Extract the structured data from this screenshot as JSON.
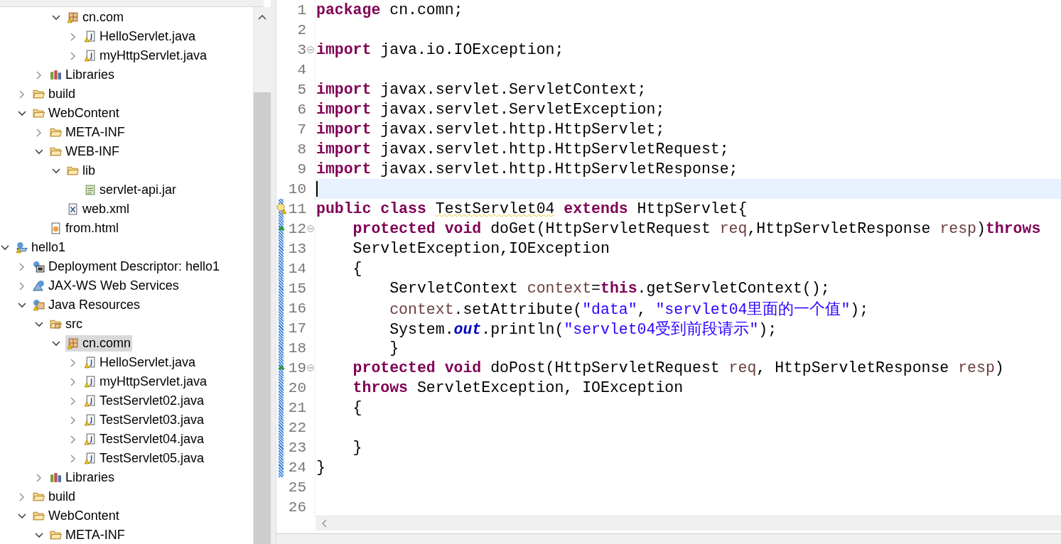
{
  "tree": [
    {
      "children": [
        {
          "children": [
            {
              "children": [
                {
                  "label": "cn.com",
                  "kind": "package",
                  "expanded": true,
                  "selected": false,
                  "children": [
                    {
                      "label": "HelloServlet.java",
                      "kind": "java-file",
                      "expanded": false,
                      "selected": false
                    },
                    {
                      "label": "myHttpServlet.java",
                      "kind": "java-file",
                      "expanded": false,
                      "selected": false
                    }
                  ]
                }
              ]
            },
            {
              "label": "Libraries",
              "kind": "library",
              "expanded": false,
              "selected": false
            }
          ]
        },
        {
          "label": "build",
          "kind": "folder",
          "expanded": false,
          "selected": false
        },
        {
          "label": "WebContent",
          "kind": "folder",
          "expanded": true,
          "selected": false,
          "children": [
            {
              "label": "META-INF",
              "kind": "folder",
              "expanded": false,
              "selected": false
            },
            {
              "label": "WEB-INF",
              "kind": "folder",
              "expanded": true,
              "selected": false,
              "children": [
                {
                  "label": "lib",
                  "kind": "folder",
                  "expanded": true,
                  "selected": false,
                  "children": [
                    {
                      "label": "servlet-api.jar",
                      "kind": "jar",
                      "selected": false
                    }
                  ]
                },
                {
                  "label": "web.xml",
                  "kind": "xml",
                  "selected": false
                }
              ]
            },
            {
              "label": "from.html",
              "kind": "html",
              "selected": false
            }
          ]
        }
      ]
    },
    {
      "label": "hello1",
      "kind": "project",
      "expanded": true,
      "selected": false,
      "children": [
        {
          "label": "Deployment Descriptor: hello1",
          "kind": "descriptor",
          "expanded": false,
          "selected": false
        },
        {
          "label": "JAX-WS Web Services",
          "kind": "web-services",
          "expanded": false,
          "selected": false
        },
        {
          "label": "Java Resources",
          "kind": "java-resources",
          "expanded": true,
          "selected": false,
          "children": [
            {
              "label": "src",
              "kind": "src-folder",
              "expanded": true,
              "selected": false,
              "children": [
                {
                  "label": "cn.comn",
                  "kind": "package",
                  "expanded": true,
                  "selected": true,
                  "children": [
                    {
                      "label": "HelloServlet.java",
                      "kind": "java-file",
                      "expanded": false,
                      "selected": false
                    },
                    {
                      "label": "myHttpServlet.java",
                      "kind": "java-file",
                      "expanded": false,
                      "selected": false
                    },
                    {
                      "label": "TestServlet02.java",
                      "kind": "java-file",
                      "expanded": false,
                      "selected": false
                    },
                    {
                      "label": "TestServlet03.java",
                      "kind": "java-file",
                      "expanded": false,
                      "selected": false
                    },
                    {
                      "label": "TestServlet04.java",
                      "kind": "java-file",
                      "expanded": false,
                      "selected": false
                    },
                    {
                      "label": "TestServlet05.java",
                      "kind": "java-file",
                      "expanded": false,
                      "selected": false
                    }
                  ]
                }
              ]
            },
            {
              "label": "Libraries",
              "kind": "library",
              "expanded": false,
              "selected": false
            }
          ]
        },
        {
          "label": "build",
          "kind": "folder",
          "expanded": false,
          "selected": false
        },
        {
          "label": "WebContent",
          "kind": "folder",
          "expanded": true,
          "selected": false,
          "children": [
            {
              "label": "META-INF",
              "kind": "folder",
              "expanded": true,
              "selected": false
            }
          ]
        }
      ]
    }
  ],
  "editor": {
    "lines": [
      {
        "number": "1",
        "current": false,
        "changed": false,
        "fold": false,
        "warning": false,
        "override": false,
        "segments": [
          {
            "kind": "keyword",
            "text": "package"
          },
          {
            "kind": "plain",
            "text": " cn.comn;"
          }
        ]
      },
      {
        "number": "2",
        "current": false,
        "changed": false,
        "fold": false,
        "warning": false,
        "override": false
      },
      {
        "number": "3",
        "current": false,
        "changed": false,
        "fold": true,
        "warning": false,
        "override": false,
        "segments": [
          {
            "kind": "keyword",
            "text": "import"
          },
          {
            "kind": "plain",
            "text": " java.io.IOException;"
          }
        ]
      },
      {
        "number": "4",
        "current": false,
        "changed": false,
        "fold": false,
        "warning": false,
        "override": false
      },
      {
        "number": "5",
        "current": false,
        "changed": false,
        "fold": false,
        "warning": false,
        "override": false,
        "segments": [
          {
            "kind": "keyword",
            "text": "import"
          },
          {
            "kind": "plain",
            "text": " javax.servlet.ServletContext;"
          }
        ]
      },
      {
        "number": "6",
        "current": false,
        "changed": false,
        "fold": false,
        "warning": false,
        "override": false,
        "segments": [
          {
            "kind": "keyword",
            "text": "import"
          },
          {
            "kind": "plain",
            "text": " javax.servlet.ServletException;"
          }
        ]
      },
      {
        "number": "7",
        "current": false,
        "changed": false,
        "fold": false,
        "warning": false,
        "override": false,
        "segments": [
          {
            "kind": "keyword",
            "text": "import"
          },
          {
            "kind": "plain",
            "text": " javax.servlet.http.HttpServlet;"
          }
        ]
      },
      {
        "number": "8",
        "current": false,
        "changed": false,
        "fold": false,
        "warning": false,
        "override": false,
        "segments": [
          {
            "kind": "keyword",
            "text": "import"
          },
          {
            "kind": "plain",
            "text": " javax.servlet.http.HttpServletRequest;"
          }
        ]
      },
      {
        "number": "9",
        "current": false,
        "changed": false,
        "fold": false,
        "warning": false,
        "override": false,
        "segments": [
          {
            "kind": "keyword",
            "text": "import"
          },
          {
            "kind": "plain",
            "text": " javax.servlet.http.HttpServletResponse;"
          }
        ]
      },
      {
        "number": "10",
        "current": true,
        "changed": false,
        "fold": false,
        "warning": false,
        "override": false
      },
      {
        "number": "11",
        "current": false,
        "changed": true,
        "fold": false,
        "warning": true,
        "override": false,
        "segments": [
          {
            "kind": "keyword",
            "text": "public class "
          },
          {
            "kind": "warning",
            "text": "TestServlet04"
          },
          {
            "kind": "keyword",
            "text": " extends"
          },
          {
            "kind": "plain",
            "text": " HttpServlet{"
          }
        ]
      },
      {
        "number": "12",
        "current": false,
        "changed": true,
        "fold": true,
        "warning": false,
        "override": true,
        "segments": [
          {
            "kind": "keyword",
            "text": "    protected void"
          },
          {
            "kind": "plain",
            "text": " doGet(HttpServletRequest "
          },
          {
            "kind": "variable",
            "text": "req"
          },
          {
            "kind": "plain",
            "text": ",HttpServletResponse "
          },
          {
            "kind": "variable",
            "text": "resp"
          },
          {
            "kind": "plain",
            "text": ")"
          },
          {
            "kind": "keyword",
            "text": "throws"
          }
        ]
      },
      {
        "number": "13",
        "current": false,
        "changed": true,
        "fold": false,
        "warning": false,
        "override": false,
        "segments": [
          {
            "kind": "plain",
            "text": "    ServletException,IOException"
          }
        ]
      },
      {
        "number": "14",
        "current": false,
        "changed": true,
        "fold": false,
        "warning": false,
        "override": false,
        "segments": [
          {
            "kind": "plain",
            "text": "    {"
          }
        ]
      },
      {
        "number": "15",
        "current": false,
        "changed": true,
        "fold": false,
        "warning": false,
        "override": false,
        "segments": [
          {
            "kind": "plain",
            "text": "        ServletContext "
          },
          {
            "kind": "variable",
            "text": "context"
          },
          {
            "kind": "plain",
            "text": "="
          },
          {
            "kind": "keyword",
            "text": "this"
          },
          {
            "kind": "plain",
            "text": ".getServletContext();"
          }
        ]
      },
      {
        "number": "16",
        "current": false,
        "changed": true,
        "fold": false,
        "warning": false,
        "override": false,
        "segments": [
          {
            "kind": "variable",
            "text": "        context"
          },
          {
            "kind": "plain",
            "text": ".setAttribute("
          },
          {
            "kind": "string",
            "text": "\"data\""
          },
          {
            "kind": "plain",
            "text": ", "
          },
          {
            "kind": "string",
            "text": "\"servlet04里面的一个值\""
          },
          {
            "kind": "plain",
            "text": ");"
          }
        ]
      },
      {
        "number": "17",
        "current": false,
        "changed": true,
        "fold": false,
        "warning": false,
        "override": false,
        "segments": [
          {
            "kind": "plain",
            "text": "        System."
          },
          {
            "kind": "field",
            "text": "out"
          },
          {
            "kind": "plain",
            "text": ".println("
          },
          {
            "kind": "string",
            "text": "\"servlet04受到前段请示\""
          },
          {
            "kind": "plain",
            "text": ");"
          }
        ]
      },
      {
        "number": "18",
        "current": false,
        "changed": true,
        "fold": false,
        "warning": false,
        "override": false,
        "segments": [
          {
            "kind": "plain",
            "text": "        }"
          }
        ]
      },
      {
        "number": "19",
        "current": false,
        "changed": true,
        "fold": true,
        "warning": false,
        "override": true,
        "segments": [
          {
            "kind": "keyword",
            "text": "    protected void"
          },
          {
            "kind": "plain",
            "text": " doPost(HttpServletRequest "
          },
          {
            "kind": "variable",
            "text": "req"
          },
          {
            "kind": "plain",
            "text": ", HttpServletResponse "
          },
          {
            "kind": "variable",
            "text": "resp"
          },
          {
            "kind": "plain",
            "text": ")"
          }
        ]
      },
      {
        "number": "20",
        "current": false,
        "changed": true,
        "fold": false,
        "warning": false,
        "override": false,
        "segments": [
          {
            "kind": "keyword",
            "text": "    throws"
          },
          {
            "kind": "plain",
            "text": " ServletException, IOException"
          }
        ]
      },
      {
        "number": "21",
        "current": false,
        "changed": true,
        "fold": false,
        "warning": false,
        "override": false,
        "segments": [
          {
            "kind": "plain",
            "text": "    {"
          }
        ]
      },
      {
        "number": "22",
        "current": false,
        "changed": true,
        "fold": false,
        "warning": false,
        "override": false
      },
      {
        "number": "23",
        "current": false,
        "changed": true,
        "fold": false,
        "warning": false,
        "override": false,
        "segments": [
          {
            "kind": "plain",
            "text": "    }"
          }
        ]
      },
      {
        "number": "24",
        "current": false,
        "changed": true,
        "fold": false,
        "warning": false,
        "override": false,
        "segments": [
          {
            "kind": "plain",
            "text": "}"
          }
        ]
      },
      {
        "number": "25",
        "current": false,
        "changed": false,
        "fold": false,
        "warning": false,
        "override": false
      },
      {
        "number": "26",
        "current": false,
        "changed": false,
        "fold": false,
        "warning": false,
        "override": false
      }
    ]
  }
}
